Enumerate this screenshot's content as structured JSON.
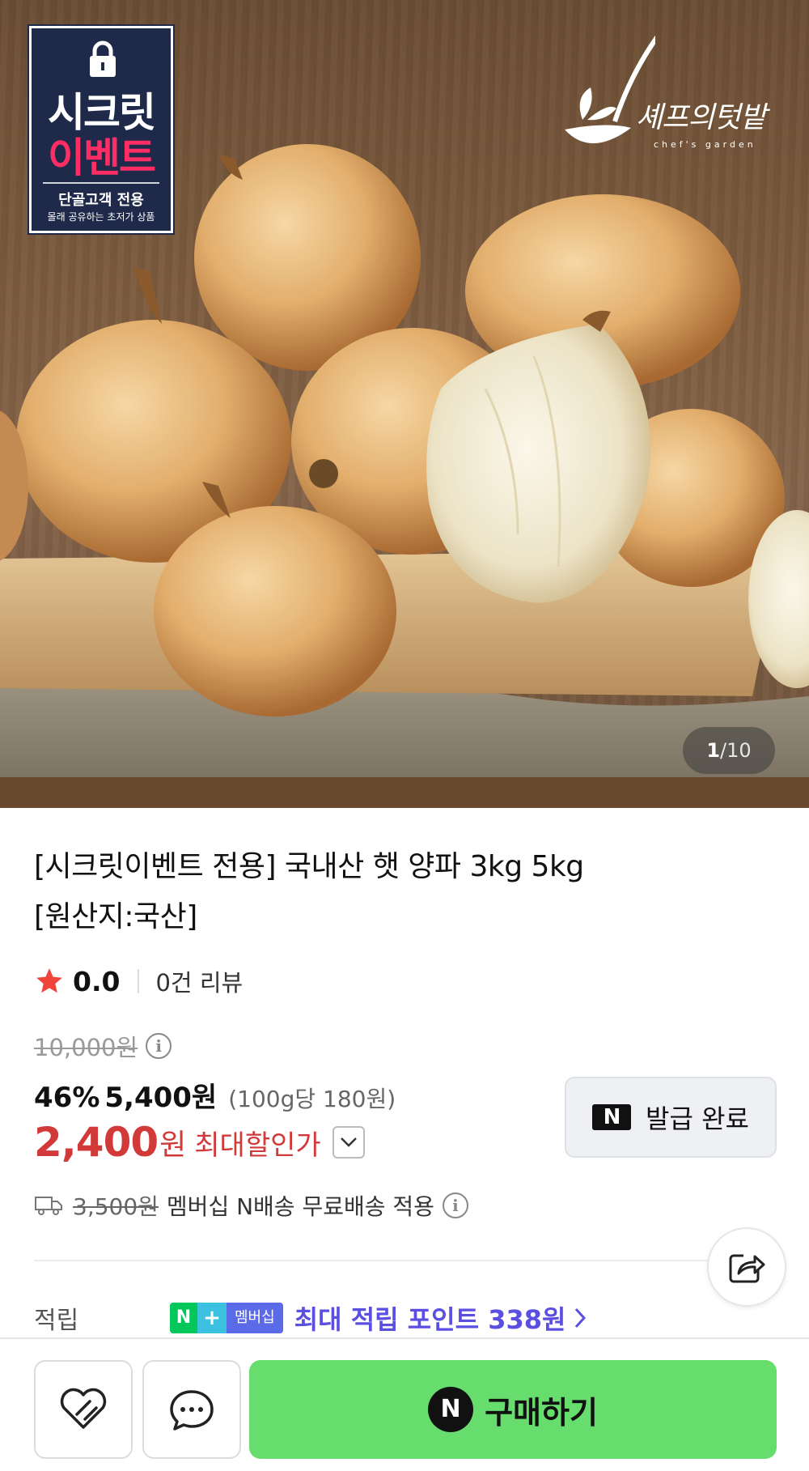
{
  "badge": {
    "line1": "시크릿",
    "line2": "이벤트",
    "sub1": "단골고객 전용",
    "sub2": "몰래 공유하는 초저가 상품",
    "icon": "lock-icon"
  },
  "brand": {
    "name": "셰프의텃밭",
    "sub": "chef's garden"
  },
  "gallery": {
    "current": "1",
    "separator": "/",
    "total": "10"
  },
  "product": {
    "title_line1": "[시크릿이벤트 전용] 국내산 햇 양파 3kg 5kg",
    "title_line2": "[원산지:국산]"
  },
  "rating": {
    "score": "0.0",
    "reviews": "0건 리뷰"
  },
  "price": {
    "original": "10,000원",
    "discount_pct": "46%",
    "sale": "5,400원",
    "unit_price": "(100g당 180원)",
    "max_price": "2,400",
    "max_won": "원",
    "max_label": "최대할인가"
  },
  "coupon": {
    "badge": "N",
    "label": "발급 완료"
  },
  "delivery": {
    "original_fee": "3,500원",
    "text": "멤버십 N배송 무료배송 적용"
  },
  "points": {
    "label": "적립",
    "badge_n": "N",
    "badge_plus": "+",
    "badge_text": "멤버십",
    "text": "최대 적립 포인트 338원"
  },
  "bottom": {
    "buy_badge": "N",
    "buy_label": "구매하기"
  },
  "colors": {
    "accent_red": "#d23a3a",
    "points_purple": "#5a4fe0",
    "buy_green": "#67dd6e",
    "badge_navy": "#1f2a4a",
    "badge_pink": "#ff2d64"
  }
}
